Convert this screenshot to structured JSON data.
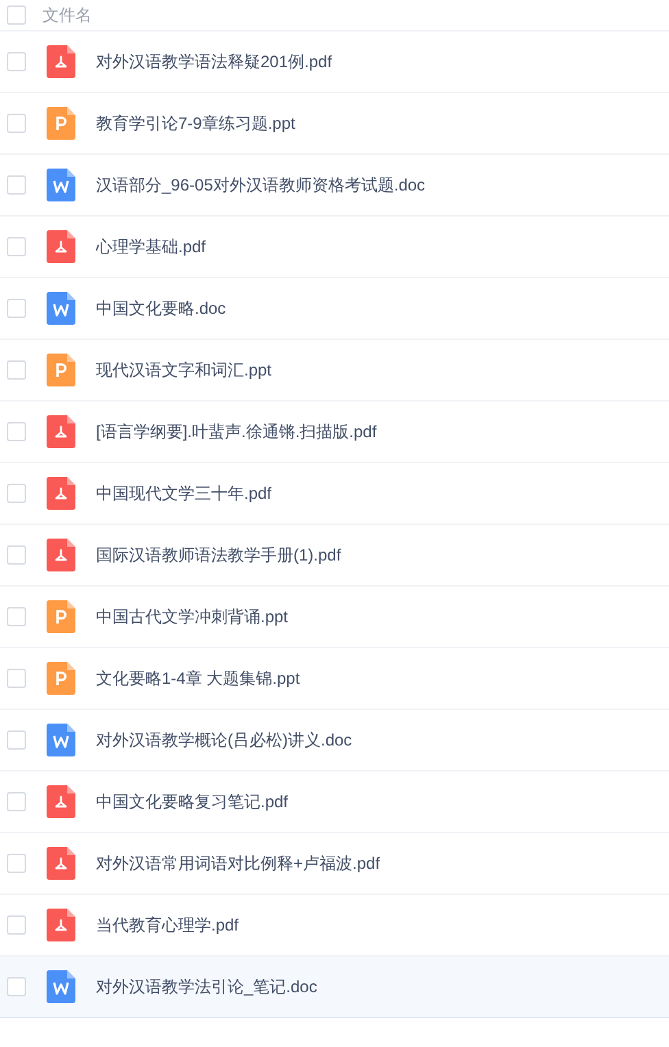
{
  "header": {
    "label": "文件名",
    "checked": false
  },
  "files": [
    {
      "name": "对外汉语教学语法释疑201例.pdf",
      "kind": "pdf",
      "checked": false,
      "selected": false
    },
    {
      "name": "教育学引论7-9章练习题.ppt",
      "kind": "ppt",
      "checked": false,
      "selected": false
    },
    {
      "name": "汉语部分_96-05对外汉语教师资格考试题.doc",
      "kind": "doc",
      "checked": false,
      "selected": false
    },
    {
      "name": "心理学基础.pdf",
      "kind": "pdf",
      "checked": false,
      "selected": false
    },
    {
      "name": "中国文化要略.doc",
      "kind": "doc",
      "checked": false,
      "selected": false
    },
    {
      "name": "现代汉语文字和词汇.ppt",
      "kind": "ppt",
      "checked": false,
      "selected": false
    },
    {
      "name": "[语言学纲要].叶蜚声.徐通锵.扫描版.pdf",
      "kind": "pdf",
      "checked": false,
      "selected": false
    },
    {
      "name": "中国现代文学三十年.pdf",
      "kind": "pdf",
      "checked": false,
      "selected": false
    },
    {
      "name": "国际汉语教师语法教学手册(1).pdf",
      "kind": "pdf",
      "checked": false,
      "selected": false
    },
    {
      "name": "中国古代文学冲刺背诵.ppt",
      "kind": "ppt",
      "checked": false,
      "selected": false
    },
    {
      "name": "文化要略1-4章 大题集锦.ppt",
      "kind": "ppt",
      "checked": false,
      "selected": false
    },
    {
      "name": "对外汉语教学概论(吕必松)讲义.doc",
      "kind": "doc",
      "checked": false,
      "selected": false
    },
    {
      "name": "中国文化要略复习笔记.pdf",
      "kind": "pdf",
      "checked": false,
      "selected": false
    },
    {
      "name": "对外汉语常用词语对比例释+卢福波.pdf",
      "kind": "pdf",
      "checked": false,
      "selected": false
    },
    {
      "name": "当代教育心理学.pdf",
      "kind": "pdf",
      "checked": false,
      "selected": false
    },
    {
      "name": "对外汉语教学法引论_笔记.doc",
      "kind": "doc",
      "checked": false,
      "selected": true
    }
  ]
}
